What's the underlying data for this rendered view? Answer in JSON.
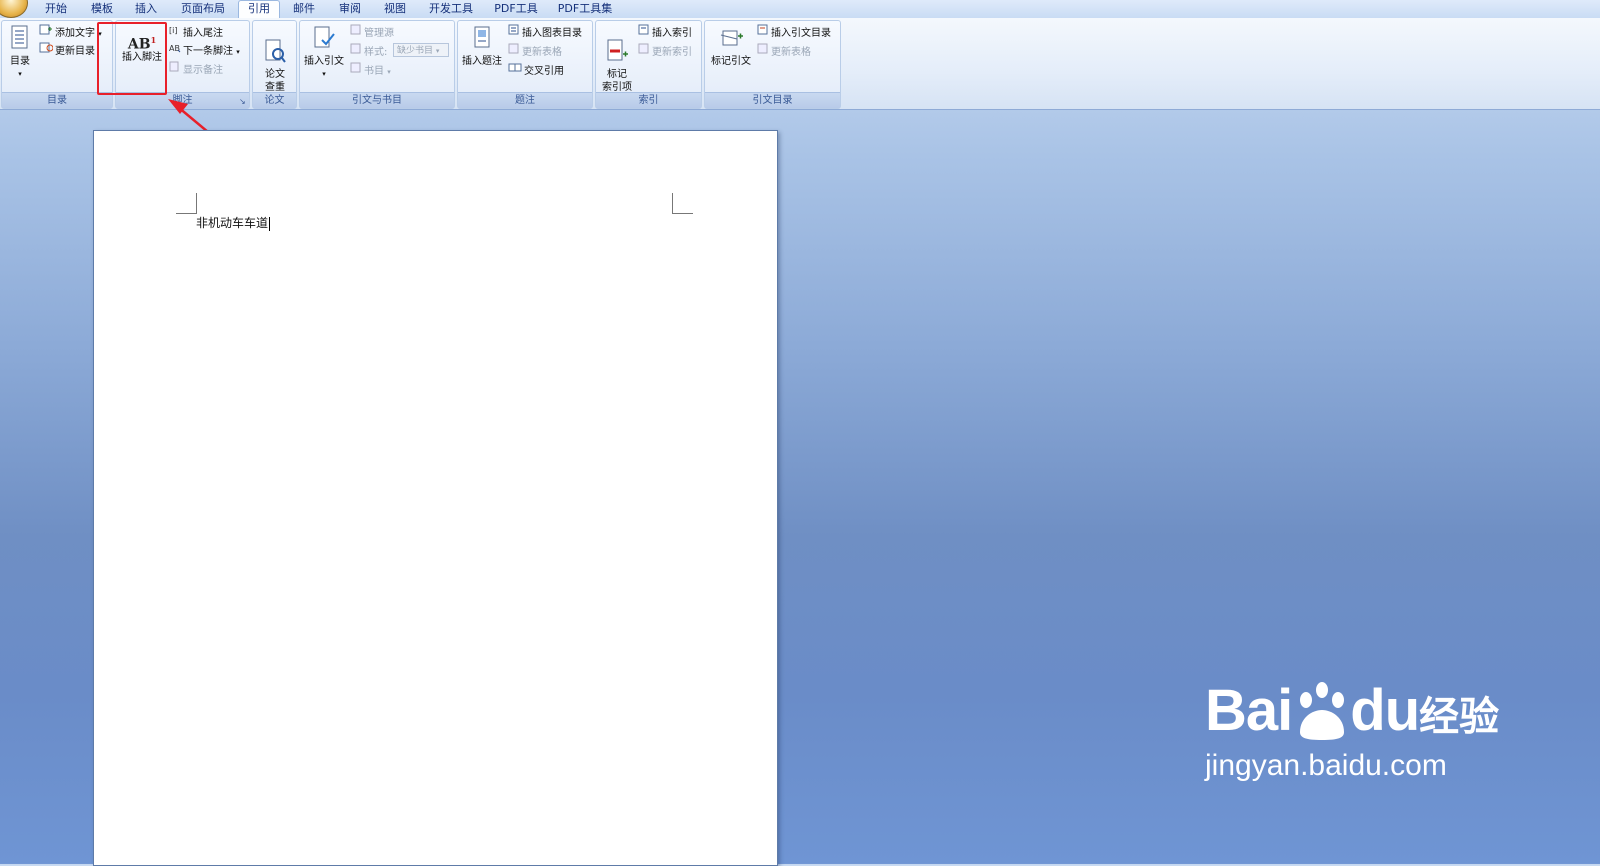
{
  "tabs": [
    "开始",
    "模板",
    "插入",
    "页面布局",
    "引用",
    "邮件",
    "审阅",
    "视图",
    "开发工具",
    "PDF工具",
    "PDF工具集"
  ],
  "active_tab": "引用",
  "ribbon": {
    "toc": {
      "label": "目录",
      "big": "目录",
      "add_text": "添加文字",
      "update_toc": "更新目录"
    },
    "footnotes": {
      "label": "脚注",
      "insert_footnote": "插入脚注",
      "insert_endnote": "插入尾注",
      "next_footnote": "下一条脚注",
      "show_notes": "显示备注",
      "footnote_icon_text": "AB",
      "footnote_sup": "1"
    },
    "paper": {
      "label": "论文",
      "check": "论文\n查重"
    },
    "citations": {
      "label": "引文与书目",
      "insert_citation": "插入引文",
      "manage_sources": "管理源",
      "style_label": "样式:",
      "style_value": "缺少书目",
      "bibliography": "书目"
    },
    "captions": {
      "label": "题注",
      "insert_caption": "插入题注",
      "insert_table_of_figures": "插入图表目录",
      "update_table": "更新表格",
      "cross_reference": "交叉引用"
    },
    "index": {
      "label": "索引",
      "mark_entry": "标记\n索引项",
      "insert_index": "插入索引",
      "update_index": "更新索引"
    },
    "toa": {
      "label": "引文目录",
      "mark_citation": "标记引文",
      "insert_toa": "插入引文目录",
      "update_table": "更新表格"
    }
  },
  "document": {
    "text": "非机动车车道"
  },
  "watermark": {
    "brand_bai": "Bai",
    "brand_du": "du",
    "brand_cn": "经验",
    "url": "jingyan.baidu.com"
  },
  "colors": {
    "highlight": "#e8202a",
    "ribbon_label": "#3a5a96"
  }
}
